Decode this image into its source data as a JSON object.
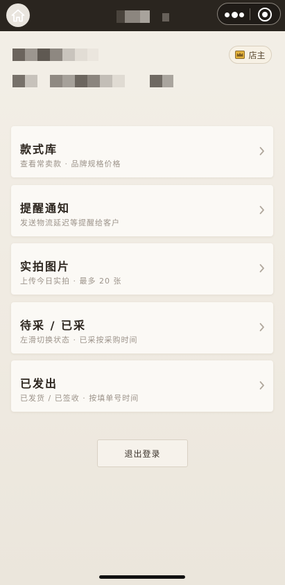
{
  "navbar": {
    "home_icon": "home-icon",
    "more_icon": "more-dots-icon",
    "mini_program_icon": "target-icon"
  },
  "profile": {
    "role_badge": "店主",
    "role_icon": "crown-icon"
  },
  "menu": [
    {
      "title": "款式库",
      "desc": "查看常卖款 · 品牌规格价格"
    },
    {
      "title": "提醒通知",
      "desc": "发送物流延迟等提醒给客户"
    },
    {
      "title": "实拍图片",
      "desc": "上传今日实拍 · 最多 20 张"
    },
    {
      "title": "待采 / 已采",
      "desc": "左滑切换状态 · 已采按采购时间"
    },
    {
      "title": "已发出",
      "desc": "已发货 / 已签收 · 按填单号时间"
    }
  ],
  "logout_label": "退出登录",
  "colors": {
    "navbar": "#2a251f",
    "background": "#f0ebe3",
    "card": "#fbf9f5",
    "accent": "#8a6a2e"
  }
}
